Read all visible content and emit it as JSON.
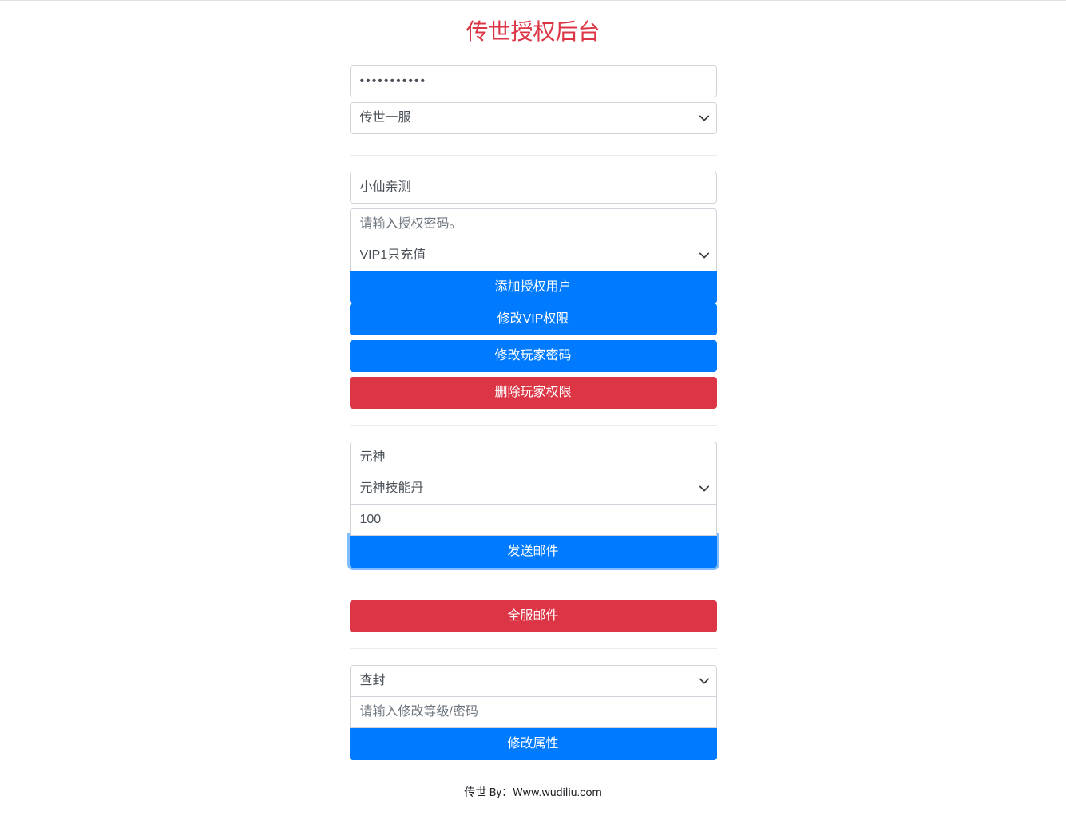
{
  "title": "传世授权后台",
  "section1": {
    "password_value": "•••••••••••",
    "server_selected": "传世一服"
  },
  "section2": {
    "username_value": "小仙亲测",
    "auth_password_placeholder": "请输入授权密码。",
    "vip_selected": "VIP1只充值",
    "btn_add_user": "添加授权用户",
    "btn_modify_vip": "修改VIP权限",
    "btn_modify_password": "修改玩家密码",
    "btn_delete_player": "删除玩家权限"
  },
  "section3": {
    "item_search_value": "元神",
    "item_selected": "元神技能丹",
    "quantity_value": "100",
    "btn_send_mail": "发送邮件"
  },
  "section4": {
    "btn_global_mail": "全服邮件"
  },
  "section5": {
    "action_selected": "查封",
    "level_password_placeholder": "请输入修改等级/密码",
    "btn_modify_attr": "修改属性"
  },
  "footer": "传世 By：Www.wudiliu.com"
}
